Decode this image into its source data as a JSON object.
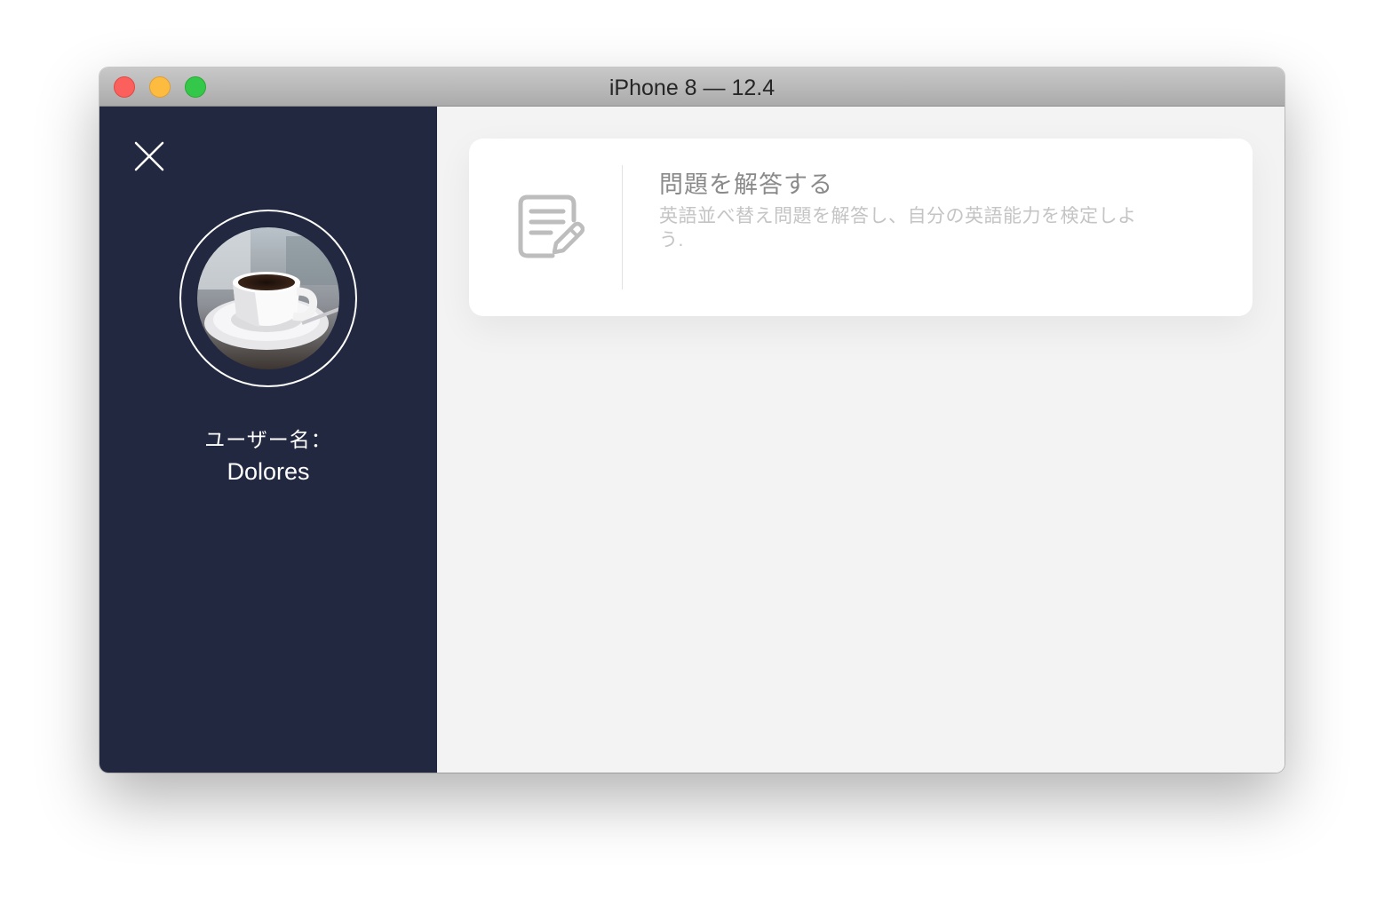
{
  "window": {
    "title": "iPhone 8 — 12.4"
  },
  "sidebar": {
    "username_label": "ユーザー名：",
    "username": "Dolores"
  },
  "card": {
    "icon": "edit-document-icon",
    "title": "問題を解答する",
    "description": "英語並べ替え問題を解答し、自分の英語能力を検定しよう."
  },
  "colors": {
    "sidebar_bg": "#232841",
    "content_bg": "#f3f3f3",
    "card_bg": "#ffffff"
  }
}
